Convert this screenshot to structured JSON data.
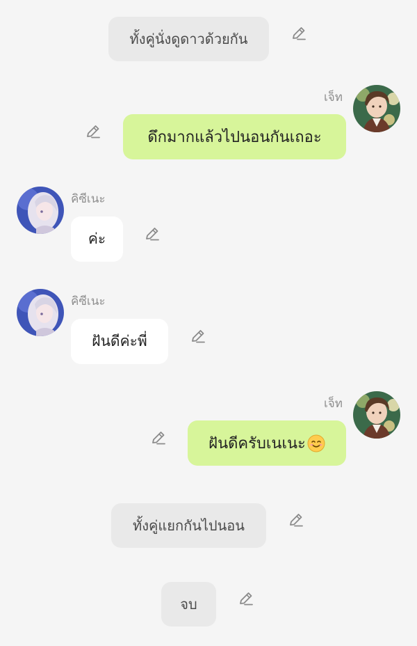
{
  "messages": {
    "n1": {
      "text": "ทั้งคู่นั่งดูดาวด้วยกัน"
    },
    "m1": {
      "sender": "เจ็ท",
      "text": "ดึกมากแล้วไปนอนกันเถอะ"
    },
    "o1": {
      "sender": "คิซีเนะ",
      "text": "ค่ะ"
    },
    "o2": {
      "sender": "คิซีเนะ",
      "text": "ฝันดีค่ะพี่"
    },
    "m2": {
      "sender": "เจ็ท",
      "text": "ฝันดีครับเนเนะ",
      "emoji": "smiling-face-emoji"
    },
    "n2": {
      "text": "ทั้งคู่แยกกันไปนอน"
    },
    "n3": {
      "text": "จบ"
    }
  },
  "icons": {
    "edit": "pencil-edit-icon"
  },
  "colors": {
    "background": "#f5f5f5",
    "me_bubble": "#d7f59a",
    "other_bubble": "#ffffff",
    "narration_bubble": "#e9e9e9",
    "name_text": "#8e8e8e"
  }
}
